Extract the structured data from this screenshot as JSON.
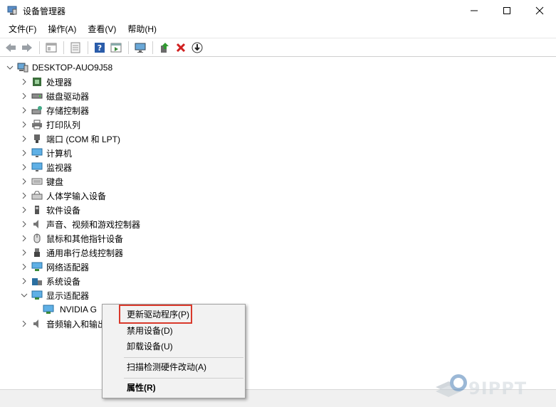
{
  "window": {
    "title": "设备管理器",
    "controls": {
      "minimize": "—",
      "maximize": "☐",
      "close": "✕"
    }
  },
  "menu": [
    "文件(F)",
    "操作(A)",
    "查看(V)",
    "帮助(H)"
  ],
  "toolbar": {
    "icons": [
      "back-arrow-icon",
      "forward-arrow-icon",
      "properties-window-icon",
      "list-view-icon",
      "help-icon",
      "details-view-icon",
      "monitor-icon",
      "update-driver-icon",
      "uninstall-icon",
      "download-icon"
    ]
  },
  "tree": {
    "root": "DESKTOP-AUO9J58",
    "nodes": [
      {
        "label": "处理器",
        "expanded": false
      },
      {
        "label": "磁盘驱动器",
        "expanded": false
      },
      {
        "label": "存储控制器",
        "expanded": false
      },
      {
        "label": "打印队列",
        "expanded": false
      },
      {
        "label": "端口 (COM 和 LPT)",
        "expanded": false
      },
      {
        "label": "计算机",
        "expanded": false
      },
      {
        "label": "监视器",
        "expanded": false
      },
      {
        "label": "键盘",
        "expanded": false
      },
      {
        "label": "人体学输入设备",
        "expanded": false
      },
      {
        "label": "软件设备",
        "expanded": false
      },
      {
        "label": "声音、视频和游戏控制器",
        "expanded": false
      },
      {
        "label": "鼠标和其他指针设备",
        "expanded": false
      },
      {
        "label": "通用串行总线控制器",
        "expanded": false
      },
      {
        "label": "网络适配器",
        "expanded": false
      },
      {
        "label": "系统设备",
        "expanded": false
      },
      {
        "label": "显示适配器",
        "expanded": true
      },
      {
        "label": "NVIDIA G",
        "child": true
      },
      {
        "label": "音频输入和输出",
        "expanded": false
      }
    ]
  },
  "context_menu": {
    "items": [
      "更新驱动程序(P)",
      "禁用设备(D)",
      "卸载设备(U)",
      "扫描检测硬件改动(A)",
      "属性(R)"
    ],
    "highlighted": "更新驱动程序(P)"
  },
  "watermark": {
    "text": "9IPPT"
  },
  "colors": {
    "highlight_box": "#d9392b",
    "menu_bg": "#f2f2f2",
    "status_bg": "#f0f0f0"
  }
}
